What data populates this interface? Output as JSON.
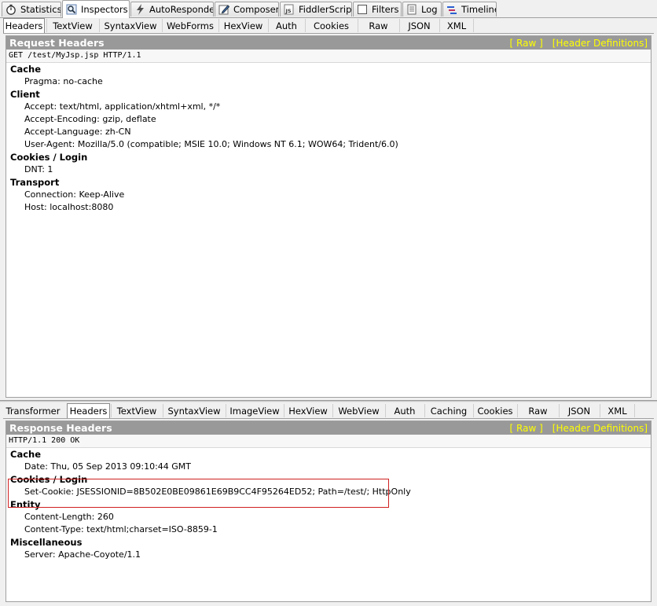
{
  "main_tabs": [
    {
      "label": "Statistics",
      "icon": "stopwatch-icon"
    },
    {
      "label": "Inspectors",
      "icon": "magnifier-icon"
    },
    {
      "label": "AutoResponder",
      "icon": "lightning-icon"
    },
    {
      "label": "Composer",
      "icon": "pencil-icon"
    },
    {
      "label": "FiddlerScript",
      "icon": "js-file-icon"
    },
    {
      "label": "Filters",
      "icon": "checkbox-icon"
    },
    {
      "label": "Log",
      "icon": "log-icon"
    },
    {
      "label": "Timeline",
      "icon": "timeline-icon"
    }
  ],
  "request": {
    "tabs": [
      "Headers",
      "TextView",
      "SyntaxView",
      "WebForms",
      "HexView",
      "Auth",
      "Cookies",
      "Raw",
      "JSON",
      "XML"
    ],
    "pane_title": "Request Headers",
    "link_raw": "[ Raw ]",
    "link_defs": "[Header Definitions]",
    "request_line": "GET /test/MyJsp.jsp HTTP/1.1",
    "groups": [
      {
        "title": "Cache",
        "items": [
          "Pragma: no-cache"
        ]
      },
      {
        "title": "Client",
        "items": [
          "Accept: text/html, application/xhtml+xml, */*",
          "Accept-Encoding: gzip, deflate",
          "Accept-Language: zh-CN",
          "User-Agent: Mozilla/5.0 (compatible; MSIE 10.0; Windows NT 6.1; WOW64; Trident/6.0)"
        ]
      },
      {
        "title": "Cookies / Login",
        "items": [
          "DNT: 1"
        ]
      },
      {
        "title": "Transport",
        "items": [
          "Connection: Keep-Alive",
          "Host: localhost:8080"
        ]
      }
    ]
  },
  "response": {
    "tabs": [
      "Transformer",
      "Headers",
      "TextView",
      "SyntaxView",
      "ImageView",
      "HexView",
      "WebView",
      "Auth",
      "Caching",
      "Cookies",
      "Raw",
      "JSON",
      "XML"
    ],
    "pane_title": "Response Headers",
    "link_raw": "[ Raw ]",
    "link_defs": "[Header Definitions]",
    "status_line": "HTTP/1.1 200 OK",
    "groups": [
      {
        "title": "Cache",
        "items": [
          "Date: Thu, 05 Sep 2013 09:10:44 GMT"
        ]
      },
      {
        "title": "Cookies / Login",
        "items": [
          "Set-Cookie: JSESSIONID=8B502E0BE09861E69B9CC4F95264ED52; Path=/test/; HttpOnly"
        ]
      },
      {
        "title": "Entity",
        "items": [
          "Content-Length: 260",
          "Content-Type: text/html;charset=ISO-8859-1"
        ]
      },
      {
        "title": "Miscellaneous",
        "items": [
          "Server: Apache-Coyote/1.1"
        ]
      }
    ]
  },
  "colors": {
    "pane_header_bg": "#999999",
    "link_color": "#ffff00",
    "highlight_border": "#d02020"
  }
}
